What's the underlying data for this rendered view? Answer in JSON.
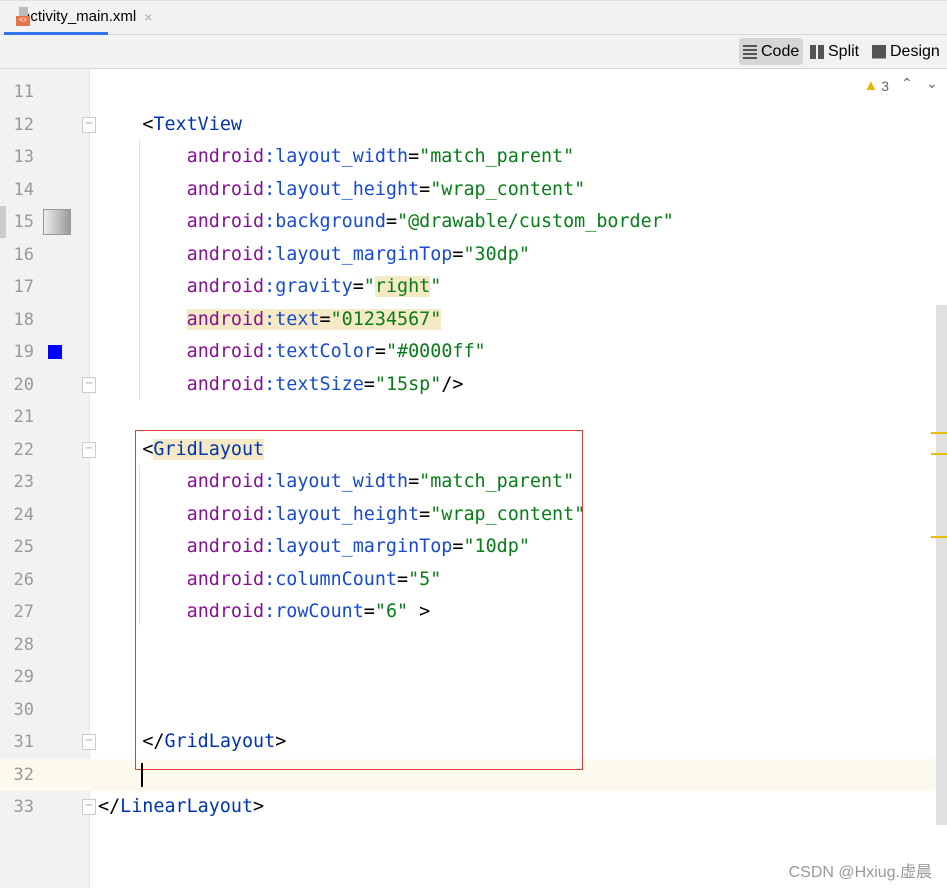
{
  "tab": {
    "filename": "activity_main.xml",
    "close_glyph": "×"
  },
  "toolbar": {
    "modes": [
      {
        "label": "Code",
        "active": true
      },
      {
        "label": "Split"
      },
      {
        "label": "Design"
      }
    ]
  },
  "inspections": {
    "warning_count": "3",
    "up": "⌃",
    "down": "⌄"
  },
  "colors": {
    "tag": "#0033b3",
    "namespace": "#871094",
    "attribute": "#174ad4",
    "value": "#067d17",
    "warning": "#e8b600",
    "selection_box": "#e53935",
    "color_swatch": "#0000ff"
  },
  "current_line": 32,
  "lines": [
    {
      "n": "11",
      "indent": 0,
      "tokens": []
    },
    {
      "n": "12",
      "indent": 4,
      "fold": "open",
      "tokens": [
        [
          "<",
          "pun"
        ],
        [
          "TextView",
          "tag"
        ]
      ]
    },
    {
      "n": "13",
      "indent": 8,
      "tokens": [
        [
          "android",
          "ns"
        ],
        [
          ":layout_width",
          "attr"
        ],
        [
          "=",
          "pun"
        ],
        [
          "\"match_parent\"",
          "val"
        ]
      ]
    },
    {
      "n": "14",
      "indent": 8,
      "tokens": [
        [
          "android",
          "ns"
        ],
        [
          ":layout_height",
          "attr"
        ],
        [
          "=",
          "pun"
        ],
        [
          "\"wrap_content\"",
          "val"
        ]
      ]
    },
    {
      "n": "15",
      "indent": 8,
      "gutter_icon": "drawable-preview",
      "tokens": [
        [
          "android",
          "ns"
        ],
        [
          ":background",
          "attr"
        ],
        [
          "=",
          "pun"
        ],
        [
          "\"@drawable/custom_border\"",
          "val"
        ]
      ]
    },
    {
      "n": "16",
      "indent": 8,
      "tokens": [
        [
          "android",
          "ns"
        ],
        [
          ":layout_marginTop",
          "attr"
        ],
        [
          "=",
          "pun"
        ],
        [
          "\"30dp\"",
          "val"
        ]
      ]
    },
    {
      "n": "17",
      "indent": 8,
      "tokens": [
        [
          "android",
          "ns"
        ],
        [
          ":gravity",
          "attr"
        ],
        [
          "=",
          "pun"
        ],
        [
          "\"",
          "val"
        ],
        [
          "right",
          "val",
          "hl"
        ],
        [
          "\"",
          "val"
        ]
      ]
    },
    {
      "n": "18",
      "indent": 8,
      "tokens": [
        [
          "android",
          "ns",
          "hl"
        ],
        [
          ":text",
          "attr",
          "hl"
        ],
        [
          "=",
          "pun",
          "hl"
        ],
        [
          "\"01234567\"",
          "val",
          "hl"
        ]
      ]
    },
    {
      "n": "19",
      "indent": 8,
      "gutter_icon": "color-swatch",
      "tokens": [
        [
          "android",
          "ns"
        ],
        [
          ":textColor",
          "attr"
        ],
        [
          "=",
          "pun"
        ],
        [
          "\"#0000ff\"",
          "val"
        ]
      ]
    },
    {
      "n": "20",
      "indent": 8,
      "fold": "close",
      "tokens": [
        [
          "android",
          "ns"
        ],
        [
          ":textSize",
          "attr"
        ],
        [
          "=",
          "pun"
        ],
        [
          "\"15sp\"",
          "val"
        ],
        [
          "/>",
          "pun"
        ]
      ]
    },
    {
      "n": "21",
      "indent": 0,
      "tokens": []
    },
    {
      "n": "22",
      "indent": 4,
      "fold": "open",
      "tokens": [
        [
          "<",
          "pun"
        ],
        [
          "GridLayout",
          "tag",
          "hl"
        ]
      ]
    },
    {
      "n": "23",
      "indent": 8,
      "tokens": [
        [
          "android",
          "ns"
        ],
        [
          ":layout_width",
          "attr"
        ],
        [
          "=",
          "pun"
        ],
        [
          "\"match_parent\"",
          "val"
        ]
      ]
    },
    {
      "n": "24",
      "indent": 8,
      "tokens": [
        [
          "android",
          "ns"
        ],
        [
          ":layout_height",
          "attr"
        ],
        [
          "=",
          "pun"
        ],
        [
          "\"wrap_content\"",
          "val"
        ]
      ]
    },
    {
      "n": "25",
      "indent": 8,
      "tokens": [
        [
          "android",
          "ns"
        ],
        [
          ":layout_marginTop",
          "attr"
        ],
        [
          "=",
          "pun"
        ],
        [
          "\"10dp\"",
          "val"
        ]
      ]
    },
    {
      "n": "26",
      "indent": 8,
      "tokens": [
        [
          "android",
          "ns"
        ],
        [
          ":columnCount",
          "attr"
        ],
        [
          "=",
          "pun"
        ],
        [
          "\"5\"",
          "val"
        ]
      ]
    },
    {
      "n": "27",
      "indent": 8,
      "tokens": [
        [
          "android",
          "ns"
        ],
        [
          ":rowCount",
          "attr"
        ],
        [
          "=",
          "pun"
        ],
        [
          "\"6\"",
          "val"
        ],
        [
          " >",
          "pun"
        ]
      ]
    },
    {
      "n": "28",
      "indent": 0,
      "tokens": []
    },
    {
      "n": "29",
      "indent": 0,
      "tokens": []
    },
    {
      "n": "30",
      "indent": 0,
      "tokens": []
    },
    {
      "n": "31",
      "indent": 4,
      "fold": "close",
      "tokens": [
        [
          "</",
          "pun"
        ],
        [
          "GridLayout",
          "tag"
        ],
        [
          ">",
          "pun"
        ]
      ]
    },
    {
      "n": "32",
      "indent": 0,
      "tokens": []
    },
    {
      "n": "33",
      "indent": 0,
      "fold": "close",
      "tokens": [
        [
          "</",
          "pun"
        ],
        [
          "LinearLayout",
          "tag"
        ],
        [
          ">",
          "pun"
        ]
      ]
    }
  ],
  "watermark": "CSDN @Hxiug.虚晨"
}
